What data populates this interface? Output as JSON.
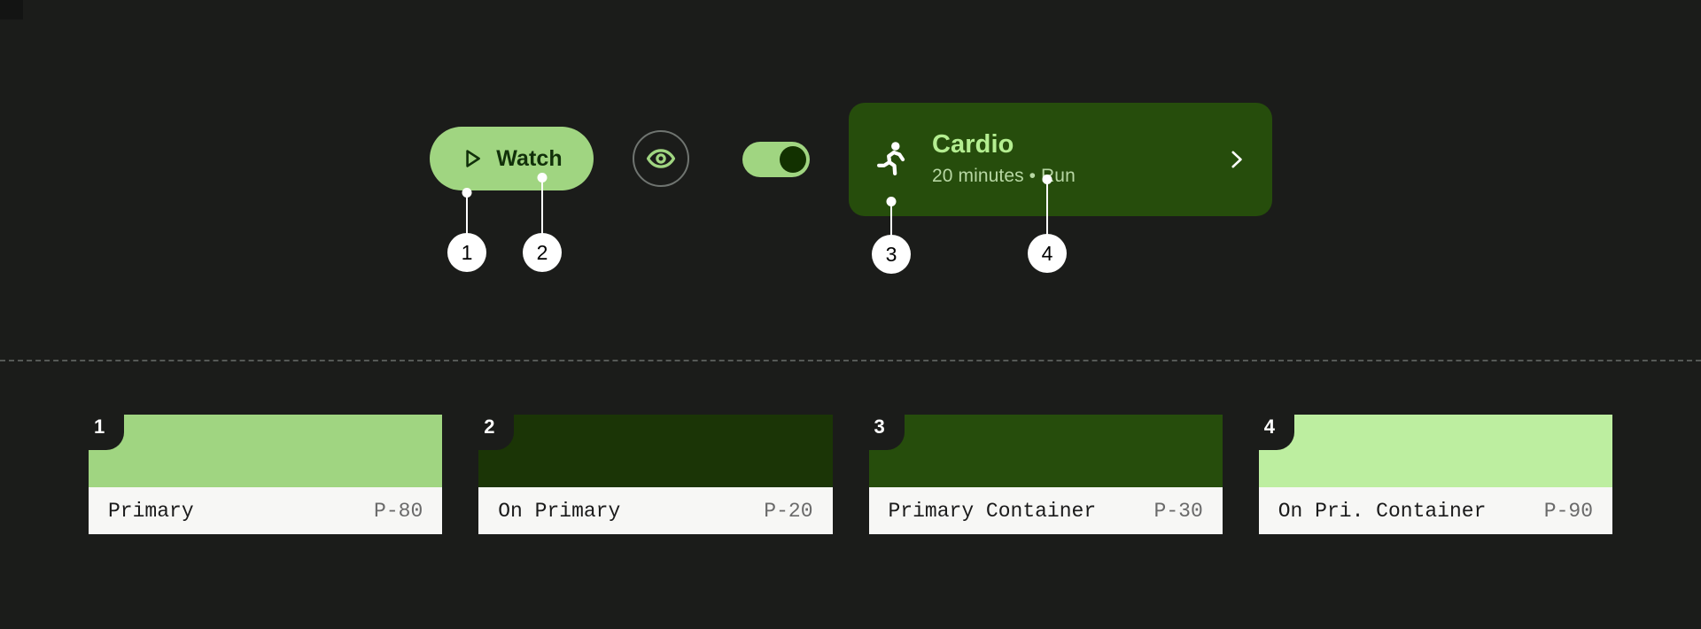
{
  "canvas": {
    "background": "#1b1c1a",
    "divider_color": "#565956"
  },
  "components": [
    {
      "name": "watch-button",
      "label": "Watch",
      "icon": "play-icon",
      "background": "#a0d581",
      "foreground": "#11300a"
    },
    {
      "name": "eye-icon-button",
      "icon": "eye-icon",
      "icon_color": "#a0d581",
      "ring_color": "#6f7470"
    },
    {
      "name": "toggle-switch",
      "state": "on",
      "track_color": "#a0d581",
      "knob_color": "#123100"
    },
    {
      "name": "cardio-card",
      "icon": "running-person-icon",
      "title": "Cardio",
      "subtitle": "20 minutes • Run",
      "chevron": "chevron-right-icon",
      "background": "#264d0c",
      "title_color": "#b4ee91",
      "subtitle_color": "#b7d7a3"
    }
  ],
  "callouts": [
    {
      "number": "1",
      "target": "watch-button-surface"
    },
    {
      "number": "2",
      "target": "watch-button-label"
    },
    {
      "number": "3",
      "target": "cardio-card-surface"
    },
    {
      "number": "4",
      "target": "cardio-card-subtitle"
    }
  ],
  "swatches": [
    {
      "badge": "1",
      "name": "Primary",
      "token": "P-80",
      "color": "#a0d581"
    },
    {
      "badge": "2",
      "name": "On Primary",
      "token": "P-20",
      "color": "#1b3506"
    },
    {
      "badge": "3",
      "name": "Primary Container",
      "token": "P-30",
      "color": "#264d0c"
    },
    {
      "badge": "4",
      "name": "On Pri. Container",
      "token": "P-90",
      "color": "#bdeea0"
    }
  ]
}
